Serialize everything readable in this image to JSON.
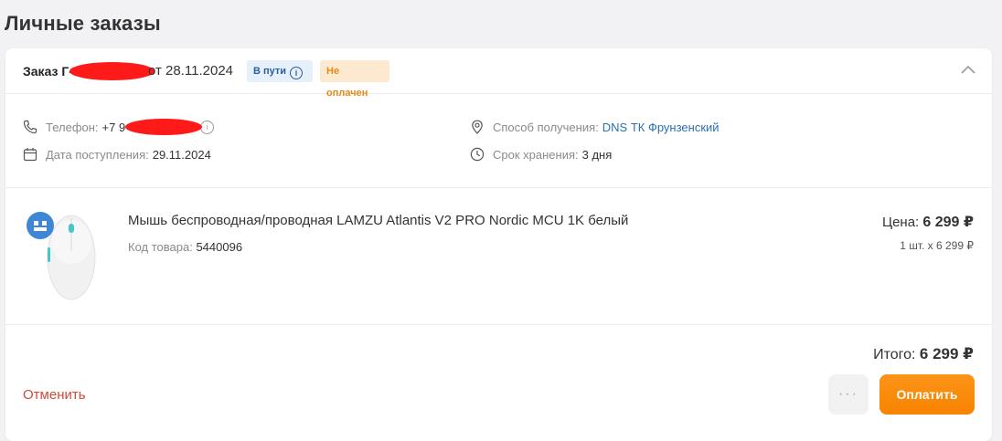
{
  "page": {
    "title": "Личные заказы"
  },
  "order": {
    "label": "Заказ Г-",
    "date": "от 28.11.2024",
    "status_transit": "В пути",
    "status_payment": "Не оплачен",
    "collapse_icon": "chevron-up-icon"
  },
  "details": {
    "phone_label": "Телефон:",
    "phone_value": "+7 9",
    "arrival_label": "Дата поступления:",
    "arrival_value": "29.11.2024",
    "pickup_label": "Способ получения:",
    "pickup_value": "DNS ТК Фрунзенский",
    "storage_label": "Срок хранения:",
    "storage_value": "3 дня"
  },
  "product": {
    "name": "Мышь беспроводная/проводная LAMZU Atlantis V2 PRO Nordic MCU 1K белый",
    "code_label": "Код товара:",
    "code_value": "5440096",
    "price_label": "Цена:",
    "price_value": "6 299 ₽",
    "price_calc": "1 шт. x 6 299 ₽"
  },
  "footer": {
    "total_label": "Итого:",
    "total_value": "6 299 ₽",
    "cancel_label": "Отменить",
    "more_label": "···",
    "pay_label": "Оплатить"
  },
  "colors": {
    "accent_orange": "#fb8a00",
    "link_blue": "#2d6fb1",
    "cancel_red": "#d04a3a",
    "badge_transit_bg": "#e6f0fb",
    "badge_unpaid_bg": "#fde9cf"
  }
}
